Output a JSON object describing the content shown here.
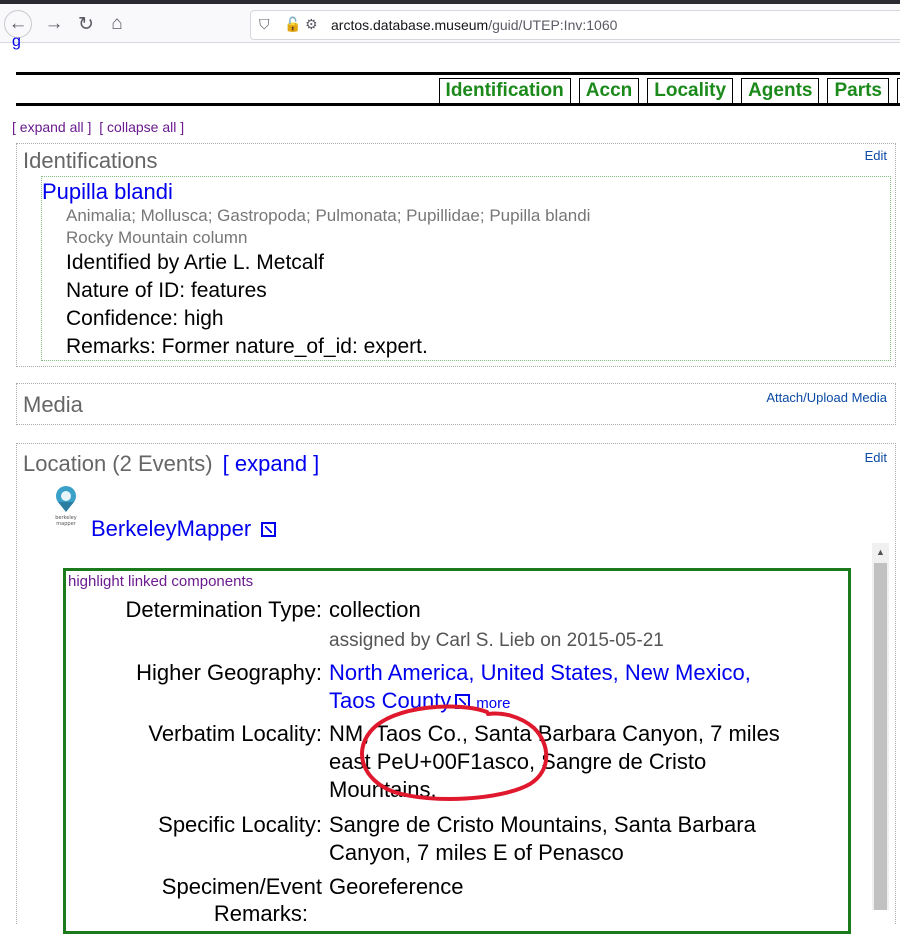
{
  "browser": {
    "url_host": "arctos.database.museum",
    "url_path": "/guid/UTEP:Inv:1060"
  },
  "nav_tabs": [
    "Identification",
    "Accn",
    "Locality",
    "Agents",
    "Parts"
  ],
  "expand_links": {
    "expand_all": "[ expand all ]",
    "collapse_all": "[ collapse all ]"
  },
  "identifications": {
    "title": "Identifications",
    "edit": "Edit",
    "taxon": "Pupilla blandi",
    "classification": "Animalia; Mollusca; Gastropoda; Pulmonata; Pupillidae; Pupilla blandi",
    "common_name": "Rocky Mountain column",
    "identified_by": "Identified by Artie L. Metcalf",
    "nature_of_id": "Nature of ID: features",
    "confidence": "Confidence: high",
    "remarks": "Remarks: Former nature_of_id: expert."
  },
  "media": {
    "title": "Media",
    "attach": "Attach/Upload Media"
  },
  "location": {
    "title": "Location (2 Events)",
    "expand": "[ expand ]",
    "edit": "Edit",
    "mapper_link": "BerkeleyMapper",
    "mapper_logo_text": "berkeley mapper",
    "highlight": "highlight linked components",
    "determination_type_label": "Determination Type:",
    "determination_type_value": "collection",
    "assigned_by": "assigned by Carl S. Lieb on 2015-05-21",
    "higher_geography_label": "Higher Geography:",
    "higher_geography_line1": "North America, United States, New Mexico,",
    "higher_geography_line2": "Taos County",
    "more": "more",
    "verbatim_locality_label": "Verbatim Locality:",
    "verbatim_locality_line1": "NM, Taos Co., Santa Barbara Canyon, 7 miles",
    "verbatim_locality_line2": "east PeU+00F1asco, Sangre de Cristo",
    "verbatim_locality_line3": "Mountains.",
    "specific_locality_label": "Specific Locality:",
    "specific_locality_line1": "Sangre de Cristo Mountains, Santa Barbara",
    "specific_locality_line2": "Canyon, 7 miles E of Penasco",
    "georef_label_line1": "Specimen/Event",
    "georef_label_line2": "Remarks:",
    "georef_value": "Georeference"
  },
  "colors": {
    "link": "#0000ee",
    "tab_text": "#1b8a1b",
    "visited": "#6b1b8f",
    "annotation": "#e0182d"
  }
}
